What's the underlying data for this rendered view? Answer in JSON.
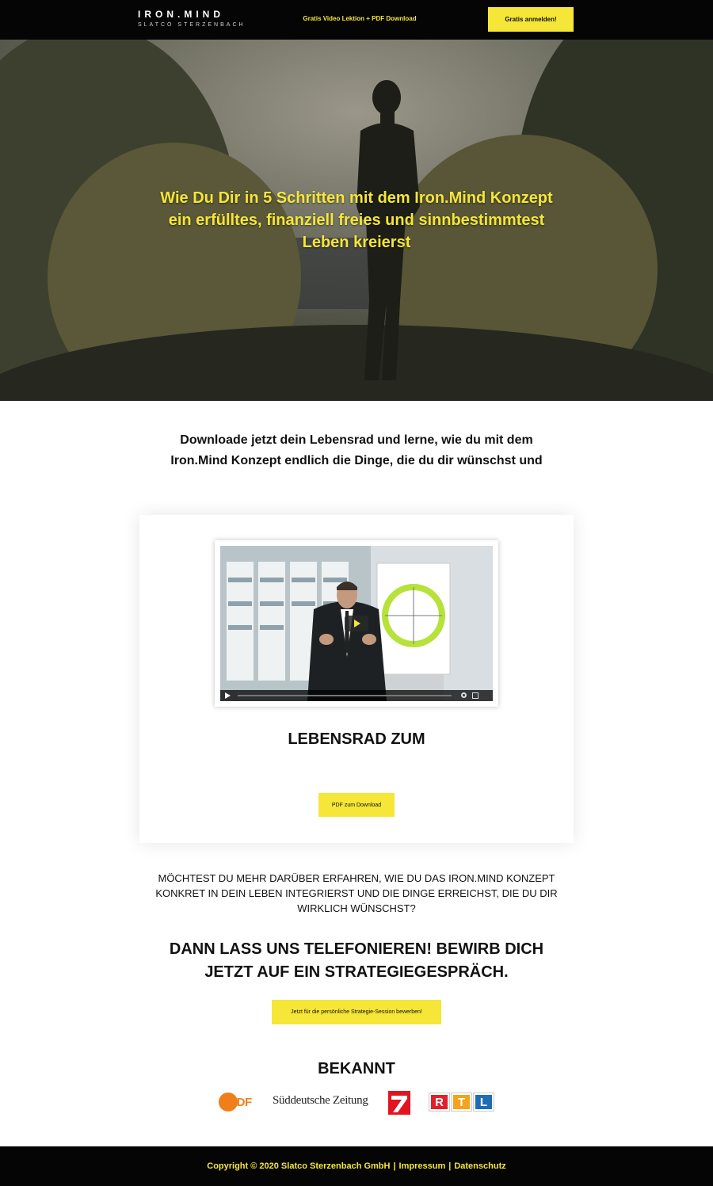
{
  "header": {
    "logo_main": "IRON.MIND",
    "logo_sub": "SLATCO STERZENBACH",
    "offer_text": "Gratis Video Lektion + PDF Download",
    "cta_label": "Gratis anmelden!"
  },
  "hero": {
    "heading": "Wie Du Dir in 5 Schritten mit dem Iron.Mind Konzept ein erfülltes, finanziell freies und sinnbestimmtest Leben kreierst"
  },
  "intro": {
    "text": "Downloade jetzt dein Lebensrad und lerne, wie du mit dem Iron.Mind Konzept endlich die Dinge, die du dir wünschst und"
  },
  "card": {
    "title": "LEBENSRAD ZUM",
    "button_label": "PDF zum Download"
  },
  "question": {
    "text": "Möchtest du mehr darüber erfahren, wie du das Iron.Mind Konzept konkret in dein Leben integrierst und die Dinge erreichst, die du dir wirklich wünschst?"
  },
  "call": {
    "heading": "DANN LASS UNS TELEFONIEREN! BEWIRB DICH JETZT AUF EIN STRATEGIEGESPRÄCH.",
    "button_label": "Jetzt für die persönliche Strategie-Session bewerben!"
  },
  "known": {
    "heading": "BEKANNT",
    "logos": [
      "ZDF",
      "Süddeutsche Zeitung",
      "ProSieben",
      "RTL"
    ],
    "zdf_label": "ZDF",
    "sz_label": "Süddeutsche Zeitung",
    "rtl_letters": [
      "R",
      "T",
      "L"
    ],
    "rtl_colors": [
      "#e3202a",
      "#f4a31a",
      "#1f6db3"
    ]
  },
  "footer": {
    "copyright": "Copyright © 2020 Slatco Sterzenbach GmbH",
    "imprint_label": "Impressum",
    "privacy_label": "Datenschutz",
    "separator": "|"
  },
  "colors": {
    "accent": "#f5e637",
    "dark": "#050505"
  }
}
